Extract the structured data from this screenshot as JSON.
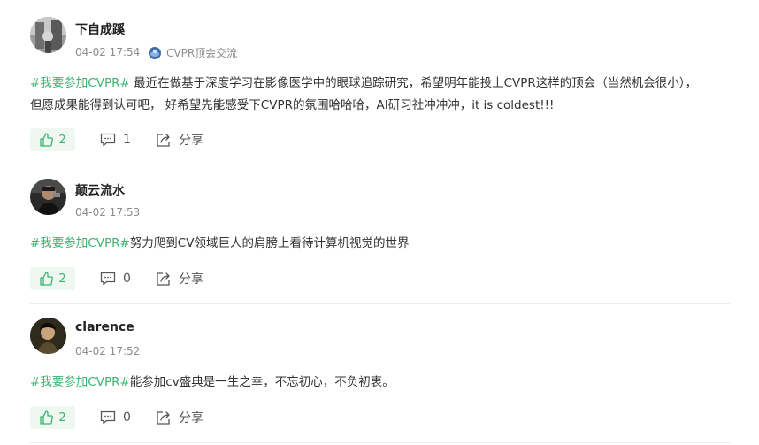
{
  "posts": [
    {
      "author": "下自成蹊",
      "time": "04-02 17:54",
      "group": "CVPR顶会交流",
      "hashtag": "#我要参加CVPR#",
      "text_line1": " 最近在做基于深度学习在影像医学中的眼球追踪研究，希望明年能投上CVPR这样的顶会（当然机会很小），",
      "text_line2": "但愿成果能得到认可吧， 好希望先能感受下CVPR的氛围哈哈哈，AI研习社冲冲冲，it is coldest!!!",
      "likes": "2",
      "comments": "1",
      "share_label": "分享"
    },
    {
      "author": "颠云流水",
      "time": "04-02 17:53",
      "hashtag": "#我要参加CVPR#",
      "text_line1": "努力爬到CV领域巨人的肩膀上看待计算机视觉的世界",
      "likes": "2",
      "comments": "0",
      "share_label": "分享"
    },
    {
      "author": "clarence",
      "time": "04-02 17:52",
      "hashtag": "#我要参加CVPR#",
      "text_line1": "能参加cv盛典是一生之幸，不忘初心，不负初衷。",
      "likes": "2",
      "comments": "0",
      "share_label": "分享"
    }
  ],
  "colors": {
    "hashtag": "#3cb371",
    "like_bg": "#eef8f1",
    "meta": "#8c8c8c",
    "divider": "#ececec"
  },
  "icons": {
    "like": "thumbs-up-icon",
    "comment": "comment-icon",
    "share": "share-icon",
    "group": "group-icon"
  }
}
